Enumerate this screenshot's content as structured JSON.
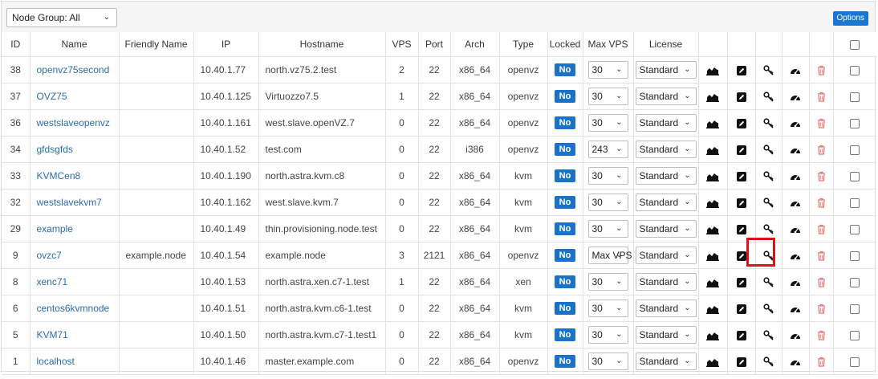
{
  "toolbar": {
    "node_group_value": "Node Group: All",
    "options_label": "Options"
  },
  "columns": [
    "ID",
    "Name",
    "Friendly Name",
    "IP",
    "Hostname",
    "VPS",
    "Port",
    "Arch",
    "Type",
    "Locked",
    "Max VPS",
    "License",
    "",
    "",
    "",
    "",
    ""
  ],
  "rows": [
    {
      "id": "38",
      "name": "openvz75second",
      "friendly": "",
      "ip": "10.40.1.77",
      "host": "north.vz75.2.test",
      "vps": "2",
      "port": "22",
      "arch": "x86_64",
      "type": "openvz",
      "locked": "No",
      "maxvps": "30",
      "license": "Standard"
    },
    {
      "id": "37",
      "name": "OVZ75",
      "friendly": "",
      "ip": "10.40.1.125",
      "host": "Virtuozzo7.5",
      "vps": "1",
      "port": "22",
      "arch": "x86_64",
      "type": "openvz",
      "locked": "No",
      "maxvps": "30",
      "license": "Standard"
    },
    {
      "id": "36",
      "name": "westslaveopenvz",
      "friendly": "",
      "ip": "10.40.1.161",
      "host": "west.slave.openVZ.7",
      "vps": "0",
      "port": "22",
      "arch": "x86_64",
      "type": "openvz",
      "locked": "No",
      "maxvps": "30",
      "license": "Standard"
    },
    {
      "id": "34",
      "name": "gfdsgfds",
      "friendly": "",
      "ip": "10.40.1.52",
      "host": "test.com",
      "vps": "0",
      "port": "22",
      "arch": "i386",
      "type": "openvz",
      "locked": "No",
      "maxvps": "243",
      "license": "Standard"
    },
    {
      "id": "33",
      "name": "KVMCen8",
      "friendly": "",
      "ip": "10.40.1.190",
      "host": "north.astra.kvm.c8",
      "vps": "0",
      "port": "22",
      "arch": "x86_64",
      "type": "kvm",
      "locked": "No",
      "maxvps": "30",
      "license": "Standard"
    },
    {
      "id": "32",
      "name": "westslavekvm7",
      "friendly": "",
      "ip": "10.40.1.162",
      "host": "west.slave.kvm.7",
      "vps": "0",
      "port": "22",
      "arch": "x86_64",
      "type": "kvm",
      "locked": "No",
      "maxvps": "30",
      "license": "Standard"
    },
    {
      "id": "29",
      "name": "example",
      "friendly": "",
      "ip": "10.40.1.49",
      "host": "thin.provisioning.node.test",
      "vps": "0",
      "port": "22",
      "arch": "x86_64",
      "type": "kvm",
      "locked": "No",
      "maxvps": "30",
      "license": "Standard"
    },
    {
      "id": "9",
      "name": "ovzc7",
      "friendly": "example.node",
      "ip": "10.40.1.54",
      "host": "example.node",
      "vps": "3",
      "port": "2121",
      "arch": "x86_64",
      "type": "openvz",
      "locked": "No",
      "maxvps": "Max VPS",
      "license": "Standard"
    },
    {
      "id": "8",
      "name": "xenc71",
      "friendly": "",
      "ip": "10.40.1.53",
      "host": "north.astra.xen.c7-1.test",
      "vps": "1",
      "port": "22",
      "arch": "x86_64",
      "type": "xen",
      "locked": "No",
      "maxvps": "30",
      "license": "Standard"
    },
    {
      "id": "6",
      "name": "centos6kvmnode",
      "friendly": "",
      "ip": "10.40.1.51",
      "host": "north.astra.kvm.c6-1.test",
      "vps": "0",
      "port": "22",
      "arch": "x86_64",
      "type": "kvm",
      "locked": "No",
      "maxvps": "30",
      "license": "Standard"
    },
    {
      "id": "5",
      "name": "KVM71",
      "friendly": "",
      "ip": "10.40.1.50",
      "host": "north.astra.kvm.c7-1.test1",
      "vps": "0",
      "port": "22",
      "arch": "x86_64",
      "type": "kvm",
      "locked": "No",
      "maxvps": "30",
      "license": "Standard"
    },
    {
      "id": "1",
      "name": "localhost",
      "friendly": "",
      "ip": "10.40.1.46",
      "host": "master.example.com",
      "vps": "0",
      "port": "22",
      "arch": "x86_64",
      "type": "openvz",
      "locked": "No",
      "maxvps": "30",
      "license": "Standard"
    }
  ],
  "icons": {
    "stats": "area-chart-icon",
    "edit": "edit-icon",
    "key": "key-icon",
    "dashboard": "gauge-icon",
    "delete": "trash-icon"
  },
  "colors": {
    "link": "#2a6db0",
    "badge": "#1a73c8",
    "delete": "#e57373",
    "highlight": "#d9141b"
  }
}
